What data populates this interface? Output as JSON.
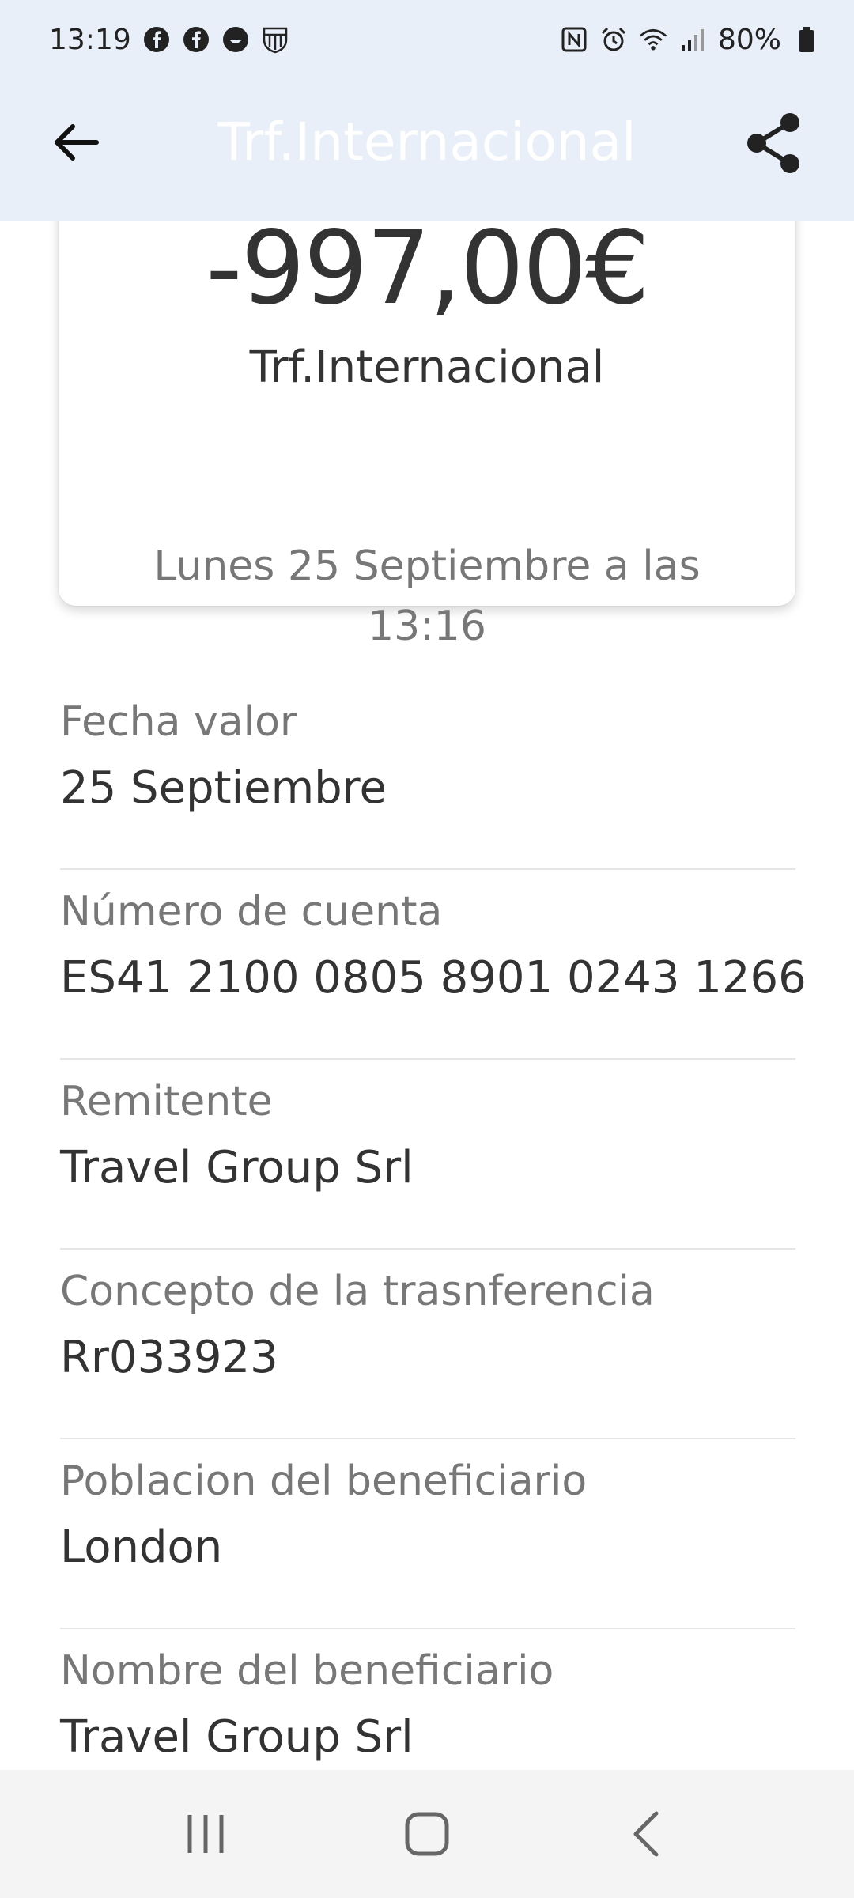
{
  "status_bar": {
    "time": "13:19",
    "battery": "80%",
    "left_icons": [
      "facebook-icon",
      "facebook-icon",
      "smiley-icon",
      "fc-barcelona-icon"
    ],
    "right_icons": [
      "nfc-icon",
      "alarm-icon",
      "wifi-icon",
      "signal-icon",
      "battery-icon"
    ]
  },
  "app_bar": {
    "title": "Trf.Internacional",
    "back_icon": "arrow-left-icon",
    "share_icon": "share-icon"
  },
  "summary": {
    "amount": "-997,00€",
    "title": "Trf.Internacional",
    "date": "Lunes 25 Septiembre a las 13:16"
  },
  "details": [
    {
      "label": "Fecha valor",
      "value": "25 Septiembre"
    },
    {
      "label": "Número de cuenta",
      "value": "ES41 2100 0805 8901 0243 1266"
    },
    {
      "label": "Remitente",
      "value": "Travel Group Srl"
    },
    {
      "label": "Concepto de la trasnferencia",
      "value": "Rr033923"
    },
    {
      "label": "Poblacion del beneficiario",
      "value": "London"
    },
    {
      "label": "Nombre del beneficiario",
      "value": "Travel Group Srl"
    }
  ],
  "nav_bar": {
    "icons": [
      "recent-apps-icon",
      "home-icon",
      "back-icon"
    ]
  },
  "colors": {
    "header_bg": "#e9eff8",
    "text_primary": "#333333",
    "text_secondary": "#777777",
    "divider": "#e6e6e6",
    "nav_bg": "#f4f4f4"
  }
}
